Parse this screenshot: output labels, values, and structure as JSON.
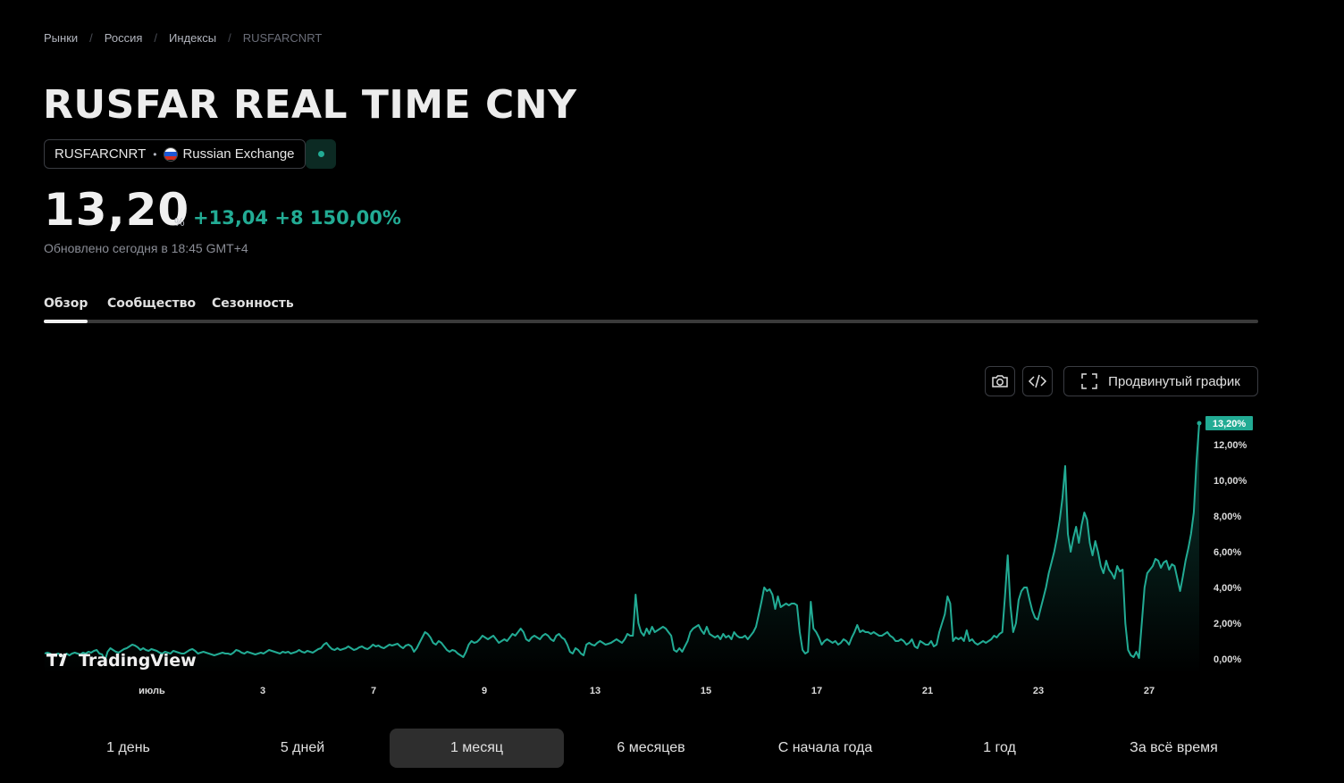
{
  "breadcrumb": [
    "Рынки",
    "Россия",
    "Индексы",
    "RUSFARCNRT"
  ],
  "title": "RUSFAR REAL TIME CNY",
  "symbol": {
    "ticker": "RUSFARCNRT",
    "exchange": "Russian Exchange"
  },
  "quote": {
    "price": "13,20",
    "unit": "%",
    "change": "+13,04",
    "change_percent": "+8 150,00%",
    "updated": "Обновлено сегодня в 18:45 GMT+4"
  },
  "tabs": [
    "Обзор",
    "Сообщество",
    "Сезонность"
  ],
  "toolbar": {
    "advanced_label": "Продвинутый график"
  },
  "logo_text": "TradingView",
  "ranges": [
    "1 день",
    "5 дней",
    "1 месяц",
    "6 месяцев",
    "С начала года",
    "1 год",
    "За всё время"
  ],
  "colors": {
    "accent": "#22ab94",
    "background": "#000000"
  },
  "chart_data": {
    "type": "area",
    "x_ticks": [
      "июль",
      "3",
      "7",
      "9",
      "13",
      "15",
      "17",
      "21",
      "23",
      "27"
    ],
    "y_ticks": [
      "0,00%",
      "2,00%",
      "4,00%",
      "6,00%",
      "8,00%",
      "10,00%",
      "12,00%"
    ],
    "last_value_label": "13,20%",
    "ylim": [
      -0.4,
      13.4
    ],
    "values": [
      0.3,
      0.35,
      0.3,
      0.2,
      0.25,
      0.3,
      0.2,
      0.15,
      0.3,
      0.2,
      0.3,
      0.35,
      0.3,
      0.25,
      0.35,
      0.3,
      0.4,
      0.35,
      0.45,
      0.5,
      0.3,
      0.25,
      -0.1,
      0.4,
      0.6,
      0.5,
      0.4,
      0.35,
      0.45,
      0.55,
      0.6,
      0.7,
      0.8,
      0.75,
      0.65,
      0.5,
      0.6,
      0.5,
      0.45,
      0.55,
      0.5,
      0.45,
      0.35,
      0.3,
      0.4,
      0.35,
      0.3,
      0.45,
      0.4,
      0.35,
      0.3,
      0.3,
      0.4,
      0.5,
      0.55,
      0.45,
      0.3,
      0.35,
      0.4,
      0.35,
      0.3,
      0.25,
      0.2,
      0.25,
      0.3,
      0.35,
      0.3,
      0.3,
      0.25,
      0.35,
      0.5,
      0.45,
      0.35,
      0.3,
      0.4,
      0.35,
      0.3,
      0.25,
      0.3,
      0.35,
      0.3,
      0.4,
      0.5,
      0.45,
      0.4,
      0.35,
      0.3,
      0.4,
      0.35,
      0.4,
      0.3,
      0.35,
      0.4,
      0.5,
      0.4,
      0.35,
      0.45,
      0.4,
      0.35,
      0.45,
      0.55,
      0.6,
      0.8,
      0.9,
      0.7,
      0.55,
      0.5,
      0.6,
      0.5,
      0.55,
      0.6,
      0.7,
      0.6,
      0.5,
      0.55,
      0.65,
      0.7,
      0.6,
      0.55,
      0.65,
      0.8,
      0.7,
      0.75,
      0.65,
      0.6,
      0.7,
      0.8,
      0.75,
      0.8,
      0.85,
      0.7,
      0.6,
      0.75,
      0.8,
      0.7,
      0.4,
      0.6,
      0.9,
      1.2,
      1.5,
      1.4,
      1.2,
      0.9,
      0.8,
      1.0,
      0.9,
      0.7,
      0.5,
      0.4,
      0.5,
      0.45,
      0.3,
      0.2,
      0.1,
      0.4,
      0.8,
      1.0,
      0.9,
      0.95,
      1.1,
      1.3,
      1.2,
      1.1,
      1.2,
      1.3,
      1.1,
      0.9,
      1.0,
      1.1,
      1.0,
      1.2,
      1.4,
      1.3,
      1.5,
      1.7,
      1.5,
      1.1,
      1.0,
      1.2,
      1.3,
      1.2,
      1.1,
      1.3,
      1.4,
      1.3,
      1.1,
      1.0,
      1.3,
      1.4,
      1.2,
      1.1,
      0.8,
      0.4,
      0.3,
      0.6,
      0.5,
      0.3,
      0.2,
      0.8,
      0.9,
      0.8,
      0.75,
      0.9,
      1.0,
      0.9,
      0.8,
      0.85,
      0.9,
      1.0,
      1.1,
      1.0,
      0.9,
      1.1,
      1.4,
      1.3,
      1.3,
      3.6,
      2.0,
      1.5,
      1.3,
      1.7,
      1.4,
      1.8,
      1.5,
      1.6,
      1.7,
      1.8,
      1.7,
      1.5,
      1.3,
      0.5,
      0.4,
      0.6,
      0.4,
      0.7,
      1.0,
      1.5,
      1.7,
      1.8,
      1.9,
      1.6,
      1.4,
      1.8,
      1.4,
      1.3,
      1.2,
      1.3,
      1.1,
      1.4,
      1.2,
      1.3,
      1.1,
      1.5,
      1.3,
      1.2,
      1.2,
      1.3,
      1.1,
      1.3,
      1.5,
      1.8,
      2.5,
      3.2,
      4.0,
      3.8,
      3.9,
      3.6,
      2.8,
      3.5,
      2.9,
      3.0,
      3.1,
      3.0,
      3.1,
      3.1,
      3.0,
      1.5,
      0.5,
      0.3,
      0.4,
      3.2,
      1.7,
      1.5,
      1.2,
      0.8,
      1.0,
      1.1,
      1.0,
      0.9,
      1.0,
      0.8,
      0.9,
      1.1,
      1.0,
      0.8,
      1.2,
      1.5,
      1.9,
      1.5,
      1.6,
      1.5,
      1.5,
      1.4,
      1.5,
      1.4,
      1.3,
      1.3,
      1.4,
      1.5,
      1.3,
      1.2,
      1.0,
      1.0,
      1.1,
      1.0,
      0.8,
      0.9,
      1.1,
      0.7,
      0.6,
      1.0,
      0.9,
      0.8,
      0.8,
      1.0,
      0.7,
      0.8,
      1.5,
      2.0,
      2.5,
      3.5,
      3.1,
      1.0,
      1.2,
      1.1,
      1.2,
      1.0,
      1.6,
      1.0,
      1.1,
      0.9,
      0.8,
      0.9,
      1.0,
      0.9,
      1.0,
      1.1,
      1.3,
      1.2,
      1.4,
      1.5,
      3.5,
      5.8,
      3.0,
      1.5,
      2.0,
      3.3,
      3.8,
      4.0,
      4.0,
      3.3,
      2.7,
      2.3,
      2.2,
      2.8,
      3.4,
      4.0,
      4.8,
      5.4,
      6.0,
      6.8,
      7.8,
      9.0,
      10.8,
      7.0,
      6.0,
      6.8,
      7.4,
      6.5,
      7.5,
      8.2,
      7.8,
      6.5,
      5.8,
      6.6,
      6.0,
      5.2,
      4.8,
      5.5,
      5.0,
      4.8,
      4.5,
      5.2,
      4.9,
      5.0,
      2.0,
      0.5,
      0.2,
      0.1,
      0.4,
      0.05,
      2.0,
      4.0,
      4.8,
      5.0,
      5.2,
      5.6,
      5.5,
      5.1,
      5.4,
      5.5,
      5.0,
      5.3,
      5.2,
      4.5,
      3.8,
      4.6,
      5.5,
      6.2,
      7.0,
      8.2,
      11.0,
      13.2
    ]
  }
}
